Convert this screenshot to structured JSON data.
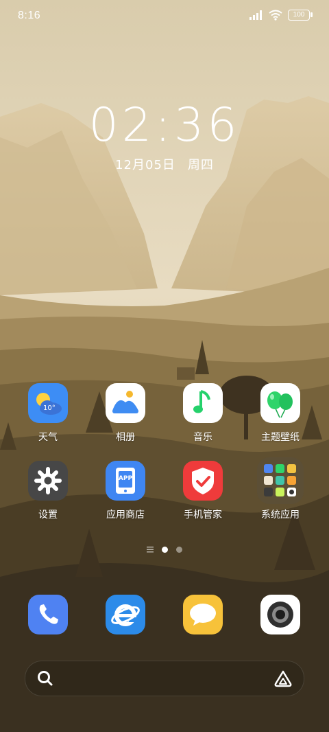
{
  "status_bar": {
    "time": "8:16",
    "battery": "100",
    "icons": [
      "signal-icon",
      "wifi-icon",
      "battery-icon"
    ]
  },
  "clock": {
    "time": "02:36",
    "date": "12月05日",
    "weekday": "周四"
  },
  "apps": [
    {
      "label": "天气",
      "icon": "weather-icon",
      "detail": "10°"
    },
    {
      "label": "相册",
      "icon": "gallery-icon"
    },
    {
      "label": "音乐",
      "icon": "music-icon"
    },
    {
      "label": "主题壁纸",
      "icon": "theme-wallpaper-icon"
    },
    {
      "label": "设置",
      "icon": "settings-gear-icon"
    },
    {
      "label": "应用商店",
      "icon": "app-store-icon",
      "detail": "APP"
    },
    {
      "label": "手机管家",
      "icon": "phone-manager-shield-icon"
    },
    {
      "label": "系统应用",
      "icon": "system-apps-folder-icon"
    }
  ],
  "page_indicator": {
    "icons": [
      "list-icon",
      "page-dot-active",
      "page-dot"
    ]
  },
  "dock": [
    {
      "icon": "phone-icon"
    },
    {
      "icon": "browser-icon"
    },
    {
      "icon": "messages-icon"
    },
    {
      "icon": "camera-icon"
    }
  ],
  "search_bar": {
    "icons": [
      "search-icon",
      "assistant-icon"
    ]
  },
  "colors": {
    "weather_bg": "#3d8df5",
    "gallery_bg": "#ffffff",
    "settings_bg": "#4a4a4a",
    "appstore_bg": "#3f86f2",
    "manager_bg": "#ef3b3b",
    "phone_bg": "#4f82f2",
    "browser_bg": "#2c8be9",
    "messages_bg": "#f7c23a"
  }
}
